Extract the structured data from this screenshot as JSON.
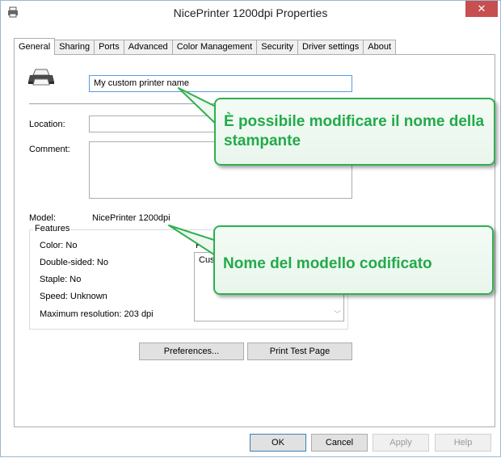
{
  "window": {
    "title": "NicePrinter 1200dpi Properties",
    "close_glyph": "✕"
  },
  "tabs": [
    {
      "label": "General",
      "active": true
    },
    {
      "label": "Sharing"
    },
    {
      "label": "Ports"
    },
    {
      "label": "Advanced"
    },
    {
      "label": "Color Management"
    },
    {
      "label": "Security"
    },
    {
      "label": "Driver settings"
    },
    {
      "label": "About"
    }
  ],
  "general": {
    "printer_name": "My custom printer name",
    "location_label": "Location:",
    "location_value": "",
    "comment_label": "Comment:",
    "comment_value": "",
    "model_label": "Model:",
    "model_value": "NicePrinter 1200dpi",
    "features_title": "Features",
    "features": [
      "Color: No",
      "Double-sided: No",
      "Staple: No",
      "Speed: Unknown",
      "Maximum resolution: 203 dpi"
    ],
    "paper_label_partial": "P",
    "paper_list_item_partial": "Cus"
  },
  "panel_buttons": {
    "preferences": "Preferences...",
    "print_test": "Print Test Page"
  },
  "dialog_buttons": {
    "ok": "OK",
    "cancel": "Cancel",
    "apply": "Apply",
    "help": "Help"
  },
  "callouts": {
    "name": "È possibile modificare il nome della stampante",
    "model": "Nome del modello codificato"
  },
  "colors": {
    "callout_border": "#2fb04f",
    "callout_text": "#22aa4a",
    "close_button": "#c74f4f"
  }
}
